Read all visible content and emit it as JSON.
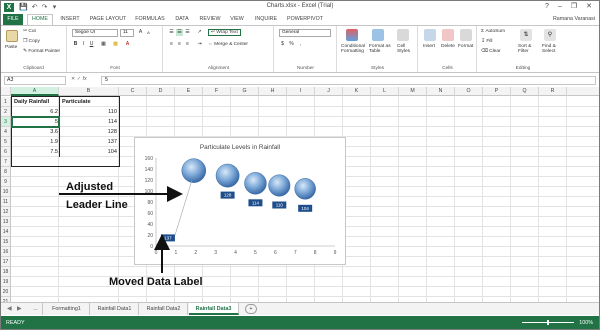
{
  "window": {
    "title": "Charts.xlsx - Excel (Trial)",
    "user": "Ramana Varanasi"
  },
  "ribbon": {
    "tabs": [
      "FILE",
      "HOME",
      "INSERT",
      "PAGE LAYOUT",
      "FORMULAS",
      "DATA",
      "REVIEW",
      "VIEW",
      "INQUIRE",
      "POWERPIVOT"
    ],
    "active_tab": "HOME",
    "clipboard": {
      "paste": "Paste",
      "cut": "Cut",
      "copy": "Copy",
      "format_painter": "Format Painter",
      "label": "Clipboard"
    },
    "font": {
      "name": "Segoe UI",
      "size": "11",
      "label": "Font"
    },
    "alignment": {
      "wrap_text": "Wrap Text",
      "merge_center": "Merge & Center",
      "label": "Alignment"
    },
    "number": {
      "format": "General",
      "currency": "$",
      "percent": "%",
      "comma": ",",
      "label": "Number"
    },
    "styles": {
      "conditional": "Conditional",
      "conditional2": "Formatting",
      "format_as": "Format as",
      "format_as2": "Table",
      "cell": "Cell",
      "cell2": "Styles",
      "label": "Styles"
    },
    "cells": {
      "insert": "Insert",
      "delete": "Delete",
      "format": "Format",
      "label": "Cells"
    },
    "editing": {
      "autosum": "AutoSum",
      "fill": "Fill",
      "clear": "Clear",
      "sort": "Sort &",
      "sort2": "Filter",
      "find": "Find &",
      "find2": "Select",
      "label": "Editing"
    }
  },
  "formula_bar": {
    "name_box": "A3",
    "fx": "fx",
    "value": "5"
  },
  "columns": [
    "A",
    "B",
    "C",
    "D",
    "E",
    "F",
    "G",
    "H",
    "I",
    "J",
    "K",
    "L",
    "M",
    "N",
    "O",
    "P",
    "Q",
    "R"
  ],
  "rows": [
    "1",
    "2",
    "3",
    "4",
    "5",
    "6",
    "7",
    "8",
    "9",
    "10",
    "11",
    "12",
    "13",
    "14",
    "15",
    "16",
    "17",
    "18",
    "19",
    "20",
    "21"
  ],
  "table": {
    "headers": [
      "Daily Rainfall",
      "Particulate"
    ],
    "rows": [
      [
        "6.2",
        "110"
      ],
      [
        "5",
        "114"
      ],
      [
        "3.6",
        "128"
      ],
      [
        "1.9",
        "137"
      ],
      [
        "7.5",
        "104"
      ]
    ]
  },
  "chart_data": {
    "type": "scatter",
    "title": "Particulate Levels in Rainfall",
    "x": [
      6.2,
      5,
      3.6,
      1.9,
      7.5
    ],
    "y": [
      110,
      114,
      128,
      137,
      104
    ],
    "bubble_values": [
      110,
      114,
      128,
      137,
      104
    ],
    "data_labels": [
      "110",
      "114",
      "128",
      "137",
      "104"
    ],
    "xlim": [
      0,
      9
    ],
    "ylim": [
      0,
      160
    ],
    "x_ticks": [
      "0",
      "1",
      "2",
      "3",
      "4",
      "5",
      "6",
      "7",
      "8",
      "9"
    ],
    "y_ticks": [
      "0",
      "20",
      "40",
      "60",
      "80",
      "100",
      "120",
      "140",
      "160"
    ],
    "moved_label": "137",
    "grid": false,
    "bubble_color": "#7aa6d6",
    "label_color": "#1f4e8c"
  },
  "annotations": {
    "adjusted_1": "Adjusted",
    "adjusted_2": "Leader Line",
    "moved": "Moved Data Label"
  },
  "sheets": {
    "ellipsis": "...",
    "tabs": [
      "Formatting1",
      "Rainfall Data1",
      "Rainfall Data2",
      "Rainfall Data3"
    ],
    "active": "Rainfall Data3",
    "add": "+"
  },
  "status": {
    "text": "READY",
    "zoom": "100%"
  }
}
